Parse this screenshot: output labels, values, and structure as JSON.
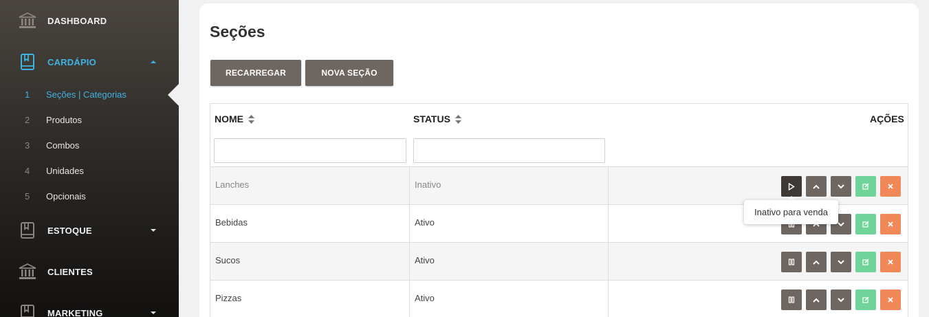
{
  "sidebar": {
    "items": [
      {
        "label": "DASHBOARD",
        "icon": "bank-icon"
      },
      {
        "label": "CARDÁPIO",
        "icon": "book-icon",
        "active": true,
        "expanded": true
      },
      {
        "label": "ESTOQUE",
        "icon": "book-icon"
      },
      {
        "label": "CLIENTES",
        "icon": "bank-icon"
      },
      {
        "label": "MARKETING",
        "icon": "book-icon"
      }
    ],
    "subitems": [
      {
        "num": "1",
        "label": "Seções | Categorias",
        "active": true
      },
      {
        "num": "2",
        "label": "Produtos"
      },
      {
        "num": "3",
        "label": "Combos"
      },
      {
        "num": "4",
        "label": "Unidades"
      },
      {
        "num": "5",
        "label": "Opcionais"
      }
    ]
  },
  "main": {
    "title": "Seções",
    "buttons": {
      "reload": "RECARREGAR",
      "new_section": "NOVA SEÇÃO"
    },
    "table": {
      "headers": {
        "name": "NOME",
        "status": "STATUS",
        "actions": "AÇÕES"
      },
      "filters": {
        "name": "",
        "status": ""
      },
      "rows": [
        {
          "name": "Lanches",
          "status": "Inativo",
          "toggle_icon": "play-icon"
        },
        {
          "name": "Bebidas",
          "status": "Ativo",
          "toggle_icon": "pause-icon"
        },
        {
          "name": "Sucos",
          "status": "Ativo",
          "toggle_icon": "pause-icon"
        },
        {
          "name": "Pizzas",
          "status": "Ativo",
          "toggle_icon": "pause-icon"
        }
      ]
    },
    "tooltip": "Inativo para venda"
  },
  "colors": {
    "accent": "#3fb3e0",
    "button": "#6e6660",
    "edit": "#6fd39a",
    "delete": "#f08858"
  }
}
